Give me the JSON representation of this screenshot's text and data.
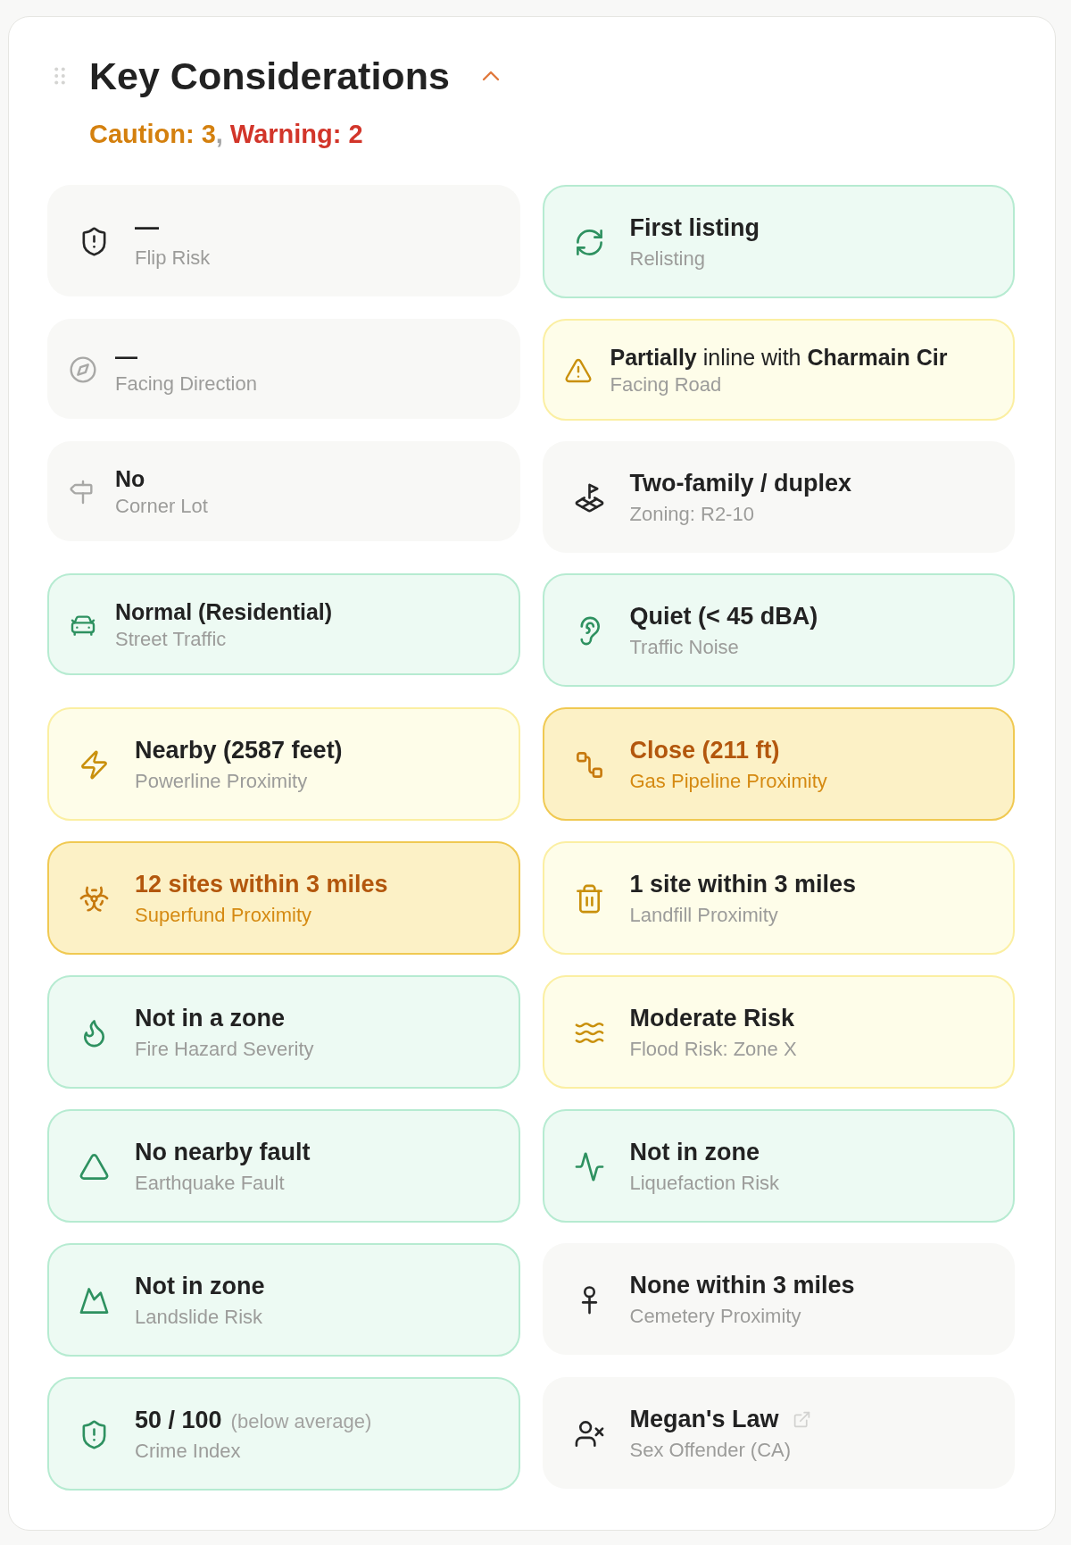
{
  "header": {
    "title": "Key Considerations",
    "expanded": true,
    "summary": [
      {
        "label": "Caution: 3",
        "kind": "caution"
      },
      {
        "label": "Warning: 2",
        "kind": "warning"
      }
    ],
    "separator": ","
  },
  "items": [
    {
      "value": "—",
      "label": "Flip Risk",
      "kind": "neutral",
      "compact": false,
      "external_link": false
    },
    {
      "value": "First listing",
      "label": "Relisting",
      "kind": "good",
      "compact": false,
      "external_link": false
    },
    {
      "value": "—",
      "label": "Facing Direction",
      "kind": "neutral",
      "compact": true,
      "external_link": false
    },
    {
      "sentence": "**Partially** inline with **Charmain Cir**",
      "label": "Facing Road",
      "kind": "caution",
      "compact": true,
      "external_link": false
    },
    {
      "value": "No",
      "label": "Corner Lot",
      "kind": "neutral",
      "compact": true,
      "external_link": false
    },
    {
      "value": "Two-family / duplex",
      "label": "Zoning: R2-10",
      "kind": "neutral",
      "compact": false,
      "external_link": false
    },
    {
      "value": "Normal (Residential)",
      "label": "Street Traffic",
      "kind": "good",
      "compact": true,
      "external_link": false
    },
    {
      "value": "Quiet (< 45 dBA)",
      "label": "Traffic Noise",
      "kind": "good",
      "compact": false,
      "external_link": false
    },
    {
      "value": "Nearby (2587 feet)",
      "label": "Powerline Proximity",
      "kind": "caution",
      "compact": false,
      "external_link": false
    },
    {
      "value": "Close (211 ft)",
      "label": "Gas Pipeline Proximity",
      "kind": "warning",
      "compact": false,
      "external_link": false
    },
    {
      "value": "12 sites within 3 miles",
      "label": "Superfund Proximity",
      "kind": "warning",
      "compact": false,
      "external_link": false
    },
    {
      "value": "1 site within 3 miles",
      "label": "Landfill Proximity",
      "kind": "caution",
      "compact": false,
      "external_link": false
    },
    {
      "value": "Not in a zone",
      "label": "Fire Hazard Severity",
      "kind": "good",
      "compact": false,
      "external_link": false
    },
    {
      "value": "Moderate Risk",
      "label": "Flood Risk: Zone X",
      "kind": "caution",
      "compact": false,
      "external_link": false
    },
    {
      "value": "No nearby fault",
      "label": "Earthquake Fault",
      "kind": "good",
      "compact": false,
      "external_link": false
    },
    {
      "value": "Not in zone",
      "label": "Liquefaction Risk",
      "kind": "good",
      "compact": false,
      "external_link": false
    },
    {
      "value": "Not in zone",
      "label": "Landslide Risk",
      "kind": "good",
      "compact": false,
      "external_link": false
    },
    {
      "value": "None within 3 miles",
      "label": "Cemetery Proximity",
      "kind": "neutral",
      "compact": false,
      "external_link": false
    },
    {
      "value": "50 / 100",
      "note": "(below average)",
      "label": "Crime Index",
      "kind": "good",
      "compact": false,
      "external_link": false
    },
    {
      "value": "Megan's Law",
      "label": "Sex Offender (CA)",
      "kind": "neutral",
      "compact": false,
      "external_link": true
    }
  ]
}
